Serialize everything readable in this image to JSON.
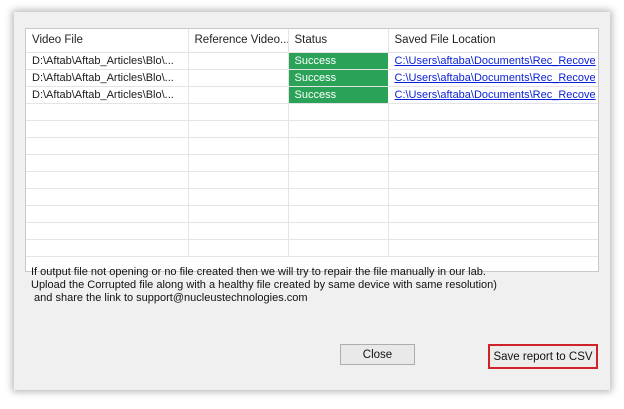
{
  "table": {
    "columns": [
      "Video File",
      "Reference Video...",
      "Status",
      "Saved File Location"
    ],
    "rows": [
      {
        "video_file": "D:\\Aftab\\Aftab_Articles\\Blo\\...",
        "reference_video": "",
        "status": "Success",
        "saved_location": "C:\\Users\\aftaba\\Documents\\Rec_Recove"
      },
      {
        "video_file": "D:\\Aftab\\Aftab_Articles\\Blo\\...",
        "reference_video": "",
        "status": "Success",
        "saved_location": "C:\\Users\\aftaba\\Documents\\Rec_Recove"
      },
      {
        "video_file": "D:\\Aftab\\Aftab_Articles\\Blo\\...",
        "reference_video": "",
        "status": "Success",
        "saved_location": "C:\\Users\\aftaba\\Documents\\Rec_Recove"
      }
    ]
  },
  "info": {
    "line1": "If output file not opening or no file created then we will try to repair the file manually in our lab.",
    "line2": "Upload the Corrupted file along with a healthy file created by same device with same resolution)",
    "line3": " and share the link to support@nucleustechnologies.com"
  },
  "buttons": {
    "close": "Close",
    "save_csv": "Save report to CSV"
  },
  "colors": {
    "status_success": "#2aa358",
    "link": "#0a1fd6",
    "highlight": "#d1222a"
  }
}
